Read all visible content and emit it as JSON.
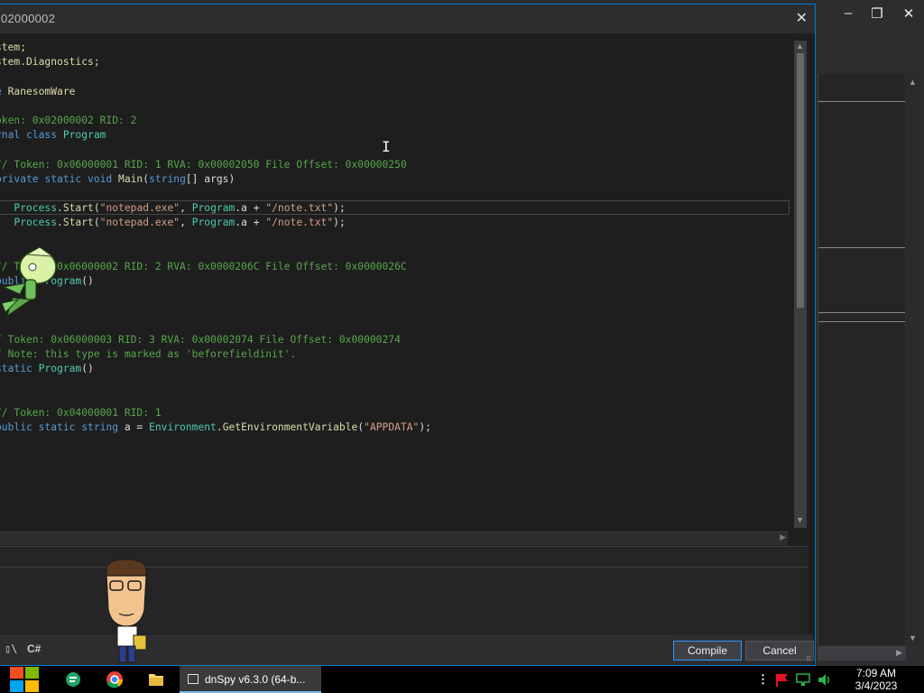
{
  "dialog": {
    "title": "02000002",
    "close_glyph": "✕",
    "code_lines": [
      [
        {
          "t": "stem;",
          "c": "c-ns"
        }
      ],
      [
        {
          "t": "stem.Diagnostics;",
          "c": "c-ns"
        }
      ],
      [],
      [
        {
          "t": "e ",
          "c": "c-kw"
        },
        {
          "t": "RanesomWare",
          "c": "c-ns"
        }
      ],
      [],
      [
        {
          "t": "oken: 0x02000002 RID: 2",
          "c": "c-com"
        }
      ],
      [
        {
          "t": "rnal class ",
          "c": "c-kw"
        },
        {
          "t": "Program",
          "c": "c-type"
        }
      ],
      [],
      [
        {
          "t": "// Token: 0x06000001 RID: 1 RVA: 0x00002050 File Offset: 0x00000250",
          "c": "c-com"
        }
      ],
      [
        {
          "t": "private static void ",
          "c": "c-kw"
        },
        {
          "t": "Main",
          "c": "c-meth"
        },
        {
          "t": "(",
          "c": ""
        },
        {
          "t": "string",
          "c": "c-kw"
        },
        {
          "t": "[] args)",
          "c": ""
        }
      ],
      [],
      [
        {
          "t": "   ",
          "c": ""
        },
        {
          "t": "Process",
          "c": "c-type"
        },
        {
          "t": ".",
          "c": ""
        },
        {
          "t": "Start",
          "c": "c-meth"
        },
        {
          "t": "(",
          "c": ""
        },
        {
          "t": "\"notepad.exe\"",
          "c": "c-str"
        },
        {
          "t": ", ",
          "c": ""
        },
        {
          "t": "Program",
          "c": "c-type"
        },
        {
          "t": ".a + ",
          "c": ""
        },
        {
          "t": "\"/note.txt\"",
          "c": "c-str"
        },
        {
          "t": ");",
          "c": ""
        }
      ],
      [
        {
          "t": "   ",
          "c": ""
        },
        {
          "t": "Process",
          "c": "c-type"
        },
        {
          "t": ".",
          "c": ""
        },
        {
          "t": "Start",
          "c": "c-meth"
        },
        {
          "t": "(",
          "c": ""
        },
        {
          "t": "\"notepad.exe\"",
          "c": "c-str"
        },
        {
          "t": ", ",
          "c": ""
        },
        {
          "t": "Program",
          "c": "c-type"
        },
        {
          "t": ".a + ",
          "c": ""
        },
        {
          "t": "\"/note.txt\"",
          "c": "c-str"
        },
        {
          "t": ");",
          "c": ""
        }
      ],
      [],
      [],
      [
        {
          "t": "// Token: 0x06000002 RID: 2 RVA: 0x0000206C File Offset: 0x0000026C",
          "c": "c-com"
        }
      ],
      [
        {
          "t": "public ",
          "c": "c-kw"
        },
        {
          "t": "Program",
          "c": "c-type"
        },
        {
          "t": "()",
          "c": ""
        }
      ],
      [],
      [],
      [],
      [
        {
          "t": "/ Token: 0x06000003 RID: 3 RVA: 0x00002074 File Offset: 0x00000274",
          "c": "c-com"
        }
      ],
      [
        {
          "t": "/ Note: this type is marked as 'beforefieldinit'.",
          "c": "c-com"
        }
      ],
      [
        {
          "t": "static ",
          "c": "c-kw"
        },
        {
          "t": "Program",
          "c": "c-type"
        },
        {
          "t": "()",
          "c": ""
        }
      ],
      [],
      [],
      [
        {
          "t": "// Token: 0x04000001 RID: 1",
          "c": "c-com"
        }
      ],
      [
        {
          "t": "public static string ",
          "c": "c-kw"
        },
        {
          "t": "a = ",
          "c": ""
        },
        {
          "t": "Environment",
          "c": "c-type"
        },
        {
          "t": ".",
          "c": ""
        },
        {
          "t": "GetEnvironmentVariable",
          "c": "c-meth"
        },
        {
          "t": "(",
          "c": ""
        },
        {
          "t": "\"APPDATA\"",
          "c": "c-str"
        },
        {
          "t": ");",
          "c": ""
        }
      ]
    ],
    "language_label": "C#",
    "compile_label": "Compile",
    "cancel_label": "Cancel"
  },
  "window_controls": {
    "minimize": "–",
    "restore": "❐",
    "close": "✕"
  },
  "taskbar": {
    "active_window_label": "dnSpy v6.3.0 (64-b...",
    "time": "7:09 AM",
    "date": "3/4/2023"
  },
  "colors": {
    "accent": "#007acc",
    "editor_bg": "#1e1e1e",
    "comment": "#57a64a",
    "keyword": "#569cd6",
    "type": "#4ec9b0",
    "string": "#d69d85"
  }
}
